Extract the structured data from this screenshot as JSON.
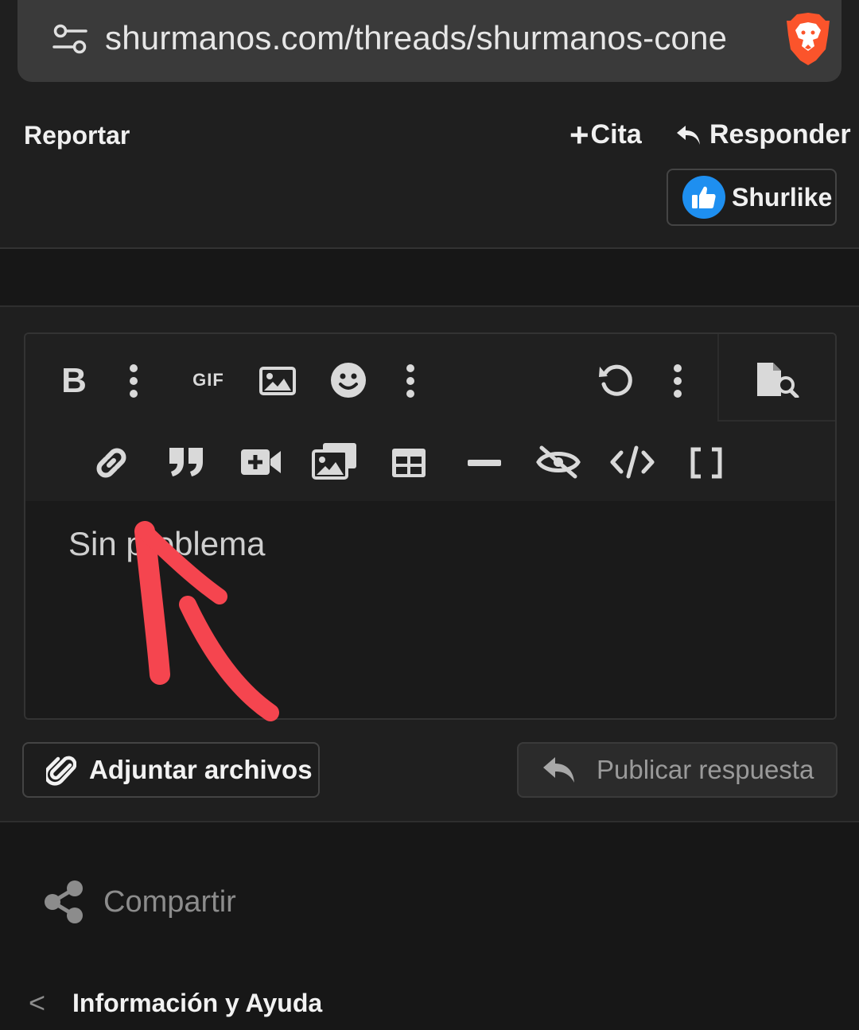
{
  "browser": {
    "url": "shurmanos.com/threads/shurmanos-cone",
    "icons": {
      "settings": "tune-icon",
      "shield": "brave-lion-icon"
    }
  },
  "post_actions": {
    "report_label": "Reportar",
    "quote_label": "Cita",
    "quote_prefix": "+",
    "reply_label": "Responder",
    "like_label": "Shurlike"
  },
  "editor": {
    "toolbar": {
      "gif_label": "GIF",
      "row1": [
        "bold-icon",
        "more-icon",
        "gif-icon",
        "image-icon",
        "emoji-icon",
        "more-icon",
        "undo-icon",
        "more-icon",
        "preview-icon"
      ],
      "row2": [
        "link-icon",
        "quote-icon",
        "video-icon",
        "media-gallery-icon",
        "table-icon",
        "horizontal-rule-icon",
        "spoiler-icon",
        "code-icon",
        "bbcode-icon"
      ]
    },
    "content_text": "Sin problema"
  },
  "buttons": {
    "attach_label": "Adjuntar archivos",
    "publish_label": "Publicar respuesta"
  },
  "footer": {
    "share_label": "Compartir",
    "info_label": "Información y Ayuda",
    "info_chevron": "<"
  },
  "colors": {
    "background": "#1f1f1f",
    "like_blue": "#1e8ff0",
    "annotation_red": "#f5454f",
    "brave_orange": "#fb542b"
  }
}
